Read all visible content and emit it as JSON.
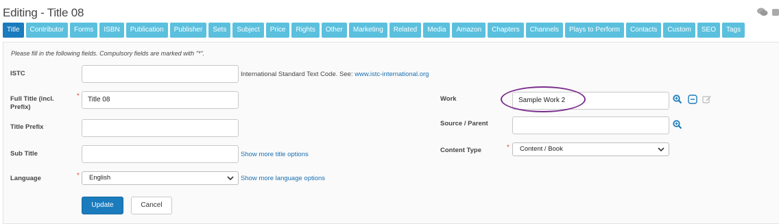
{
  "header": {
    "title": "Editing - Title 08"
  },
  "tabs": [
    {
      "label": "Title",
      "active": true
    },
    {
      "label": "Contributor"
    },
    {
      "label": "Forms"
    },
    {
      "label": "ISBN"
    },
    {
      "label": "Publication"
    },
    {
      "label": "Publisher"
    },
    {
      "label": "Sets"
    },
    {
      "label": "Subject"
    },
    {
      "label": "Price"
    },
    {
      "label": "Rights"
    },
    {
      "label": "Other"
    },
    {
      "label": "Marketing"
    },
    {
      "label": "Related"
    },
    {
      "label": "Media"
    },
    {
      "label": "Amazon"
    },
    {
      "label": "Chapters"
    },
    {
      "label": "Channels"
    },
    {
      "label": "Plays to Perform"
    },
    {
      "label": "Contacts"
    },
    {
      "label": "Custom"
    },
    {
      "label": "SEO"
    },
    {
      "label": "Tags"
    }
  ],
  "form": {
    "hint": "Please fill in the following fields. Compulsory fields are marked with \"*\".",
    "istc": {
      "label": "ISTC",
      "value": "",
      "help": "International Standard Text Code. See: ",
      "help_link": "www.istc-international.org"
    },
    "full_title": {
      "label_line1": "Full Title (incl.",
      "label_line2": "Prefix)",
      "value": "Title 08",
      "required": "*"
    },
    "title_prefix": {
      "label": "Title Prefix",
      "value": ""
    },
    "sub_title": {
      "label": "Sub Title",
      "value": "",
      "link": "Show more title options"
    },
    "language": {
      "label": "Language",
      "value": "English",
      "required": "*",
      "link": "Show more language options"
    },
    "work": {
      "label": "Work",
      "value": "Sample Work 2"
    },
    "source_parent": {
      "label": "Source / Parent",
      "value": ""
    },
    "content_type": {
      "label": "Content Type",
      "value": "Content / Book",
      "required": "*"
    },
    "update_label": "Update",
    "cancel_label": "Cancel"
  },
  "colors": {
    "tab": "#5bc0de",
    "tab_active": "#1a7bbd",
    "link": "#1a6fb0",
    "highlight": "#7b2c8e"
  },
  "icons": [
    "comments-icon",
    "puzzle-icon",
    "zoom-in-icon",
    "minus-icon",
    "edit-icon",
    "chevron-down-icon"
  ]
}
